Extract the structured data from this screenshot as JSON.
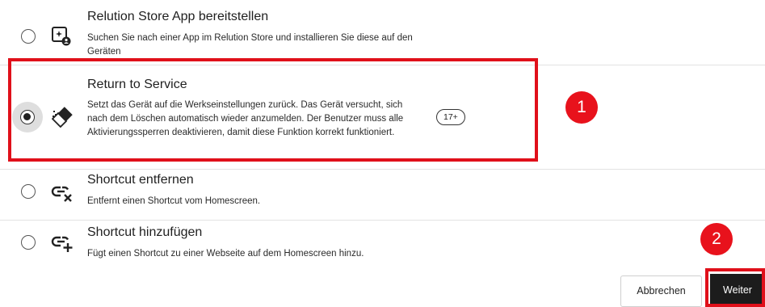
{
  "options": [
    {
      "title": "Relution Store App bereitstellen",
      "description": "Suchen Sie nach einer App im Relution Store und installieren Sie diese auf den Geräten"
    },
    {
      "title": "Return to Service",
      "description": "Setzt das Gerät auf die Werkseinstellungen zurück. Das Gerät versucht, sich nach dem Löschen automatisch wieder anzumelden. Der Benutzer muss alle Aktivierungssperren deaktivieren, damit diese Funktion korrekt funktioniert.",
      "badge": "17+",
      "selected": true
    },
    {
      "title": "Shortcut entfernen",
      "description": "Entfernt einen Shortcut vom Homescreen."
    },
    {
      "title": "Shortcut hinzufügen",
      "description": "Fügt einen Shortcut zu einer Webseite auf dem Homescreen hinzu."
    }
  ],
  "icons": [
    "store-app-icon",
    "eraser-icon",
    "link-remove-icon",
    "link-add-icon"
  ],
  "annotations": {
    "marker1": "1",
    "marker2": "2"
  },
  "buttons": {
    "cancel": "Abbrechen",
    "next": "Weiter"
  },
  "colors": {
    "highlight": "#e0101a",
    "primary_button": "#1c1c1c"
  }
}
